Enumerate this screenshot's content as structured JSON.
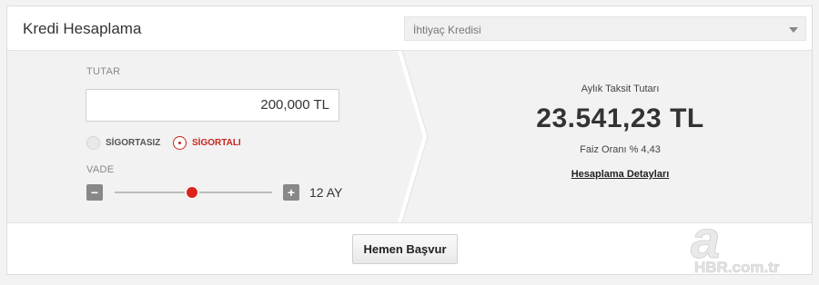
{
  "header": {
    "title": "Kredi Hesaplama",
    "loan_type": "İhtiyaç Kredisi"
  },
  "form": {
    "amount_label": "TUTAR",
    "amount_value": "200,000 TL",
    "insurance_options": [
      "SİGORTASIZ",
      "SİGORTALI"
    ],
    "insurance_selected": "SİGORTALI",
    "term_label": "VADE",
    "term_value": "12 AY",
    "term_slider_fraction": 0.49,
    "minus_label": "−",
    "plus_label": "+"
  },
  "result": {
    "monthly_label": "Aylık Taksit Tutarı",
    "monthly_value": "23.541,23 TL",
    "rate_text": "Faiz Oranı % 4,43",
    "details_link": "Hesaplama Detayları"
  },
  "footer": {
    "apply_label": "Hemen Başvur"
  },
  "watermark": {
    "logo_letter": "a",
    "text": "HBR.com.tr"
  },
  "colors": {
    "accent": "#d9231b",
    "panel_bg": "#f2f2f2"
  }
}
